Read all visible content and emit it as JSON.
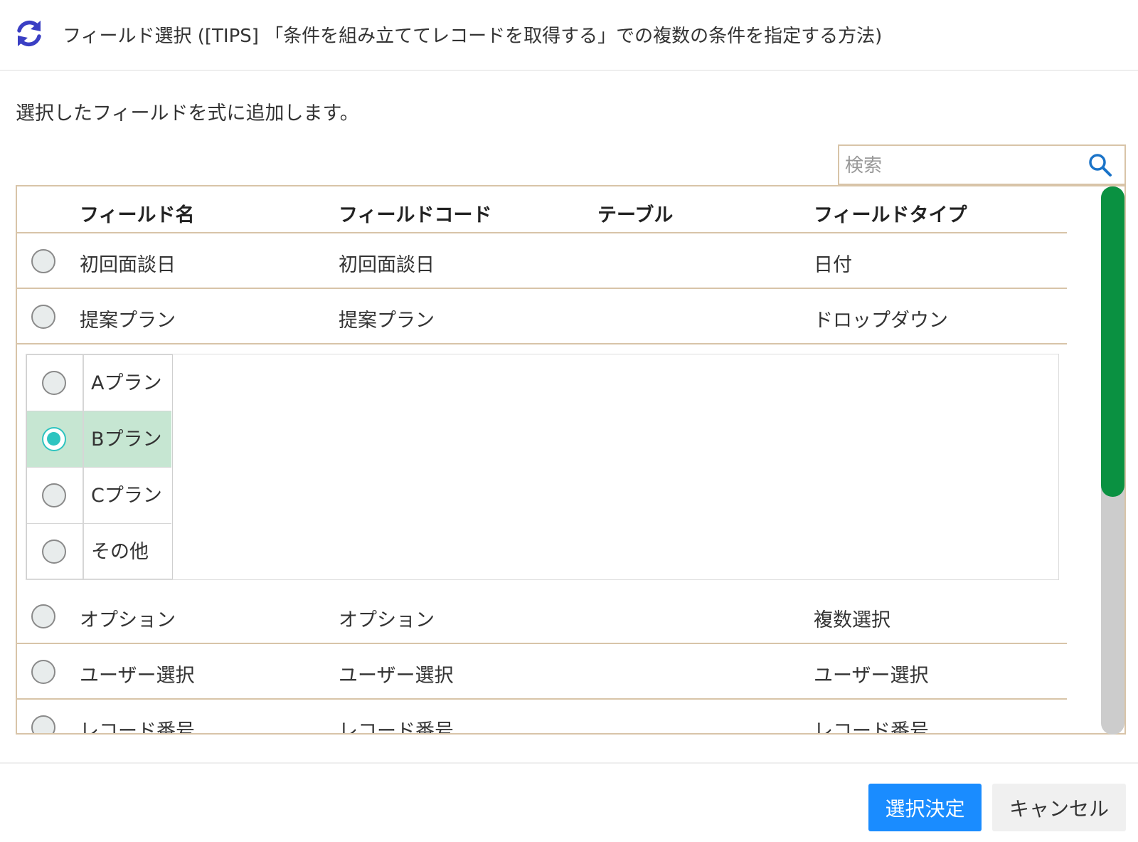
{
  "header": {
    "icon": "refresh-icon",
    "title": "フィールド選択 ([TIPS] 「条件を組み立ててレコードを取得する」での複数の条件を指定する方法)"
  },
  "description": "選択したフィールドを式に追加します。",
  "search": {
    "placeholder": "検索",
    "value": "",
    "icon": "search-icon"
  },
  "table": {
    "columns": [
      "フィールド名",
      "フィールドコード",
      "テーブル",
      "フィールドタイプ"
    ],
    "rows": [
      {
        "name": "初回面談日",
        "code": "初回面談日",
        "table": "",
        "type": "日付"
      },
      {
        "name": "提案プラン",
        "code": "提案プラン",
        "table": "",
        "type": "ドロップダウン"
      },
      {
        "name": "オプション",
        "code": "オプション",
        "table": "",
        "type": "複数選択"
      },
      {
        "name": "ユーザー選択",
        "code": "ユーザー選択",
        "table": "",
        "type": "ユーザー選択"
      },
      {
        "name": "レコード番号",
        "code": "レコード番号",
        "table": "",
        "type": "レコード番号"
      }
    ],
    "sub_options": {
      "parent": "提案プラン",
      "selected": "Bプラン",
      "items": [
        "Aプラン",
        "Bプラン",
        "Cプラン",
        "その他"
      ]
    }
  },
  "scrollbar": {
    "position_fraction": 0.0,
    "visible_fraction": 0.57
  },
  "footer": {
    "confirm_label": "選択決定",
    "cancel_label": "キャンセル"
  },
  "colors": {
    "accent": "#1a8cff",
    "selected_row": "#c6e6d2",
    "radio_checked": "#2ec4c0",
    "scroll_thumb": "#0a9141",
    "icon": "#3a3fc4"
  }
}
